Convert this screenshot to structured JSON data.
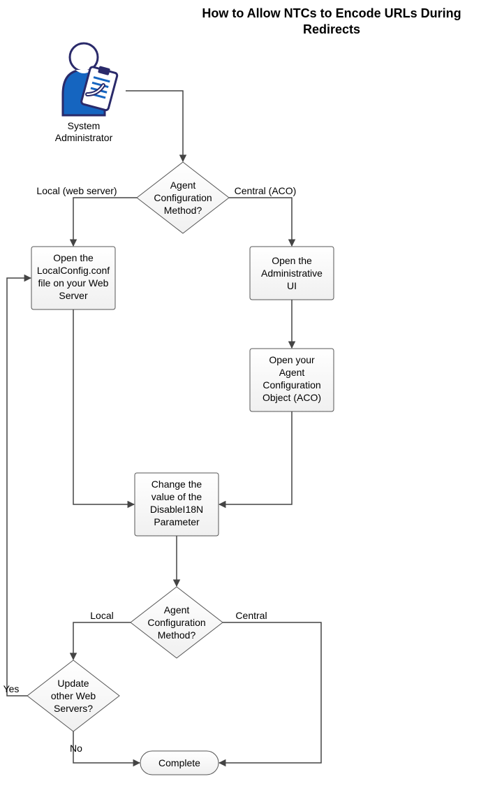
{
  "title": {
    "line1": "How to Allow NTCs to Encode URLs During",
    "line2": "Redirects"
  },
  "actor": {
    "label_line1": "System",
    "label_line2": "Administrator"
  },
  "decisions": {
    "d1": {
      "line1": "Agent",
      "line2": "Configuration",
      "line3": "Method?"
    },
    "d2": {
      "line1": "Agent",
      "line2": "Configuration",
      "line3": "Method?"
    },
    "d3": {
      "line1": "Update",
      "line2": "other Web",
      "line3": "Servers?"
    }
  },
  "boxes": {
    "local_open": {
      "line1": "Open the",
      "line2": "LocalConfig.conf",
      "line3": "file on your Web",
      "line4": "Server"
    },
    "admin_ui": {
      "line1": "Open the",
      "line2": "Administrative",
      "line3": "UI"
    },
    "open_aco": {
      "line1": "Open your",
      "line2": "Agent",
      "line3": "Configuration",
      "line4": "Object (ACO)"
    },
    "change_param": {
      "line1": "Change the",
      "line2": "value of the",
      "line3_bold": "DisableI18N",
      "line4": "Parameter"
    }
  },
  "edge_labels": {
    "d1_left": "Local (web server)",
    "d1_right": "Central (ACO)",
    "d2_left": "Local",
    "d2_right": "Central",
    "d3_yes": "Yes",
    "d3_no": "No"
  },
  "terminator": {
    "label": "Complete"
  },
  "chart_data": {
    "type": "flowchart",
    "title": "How to Allow NTCs to Encode URLs During Redirects",
    "actor": "System Administrator",
    "nodes": [
      {
        "id": "actor",
        "type": "actor",
        "label": "System Administrator"
      },
      {
        "id": "d1",
        "type": "decision",
        "label": "Agent Configuration Method?"
      },
      {
        "id": "n_local_open",
        "type": "process",
        "label": "Open the LocalConfig.conf file on your Web Server"
      },
      {
        "id": "n_admin_ui",
        "type": "process",
        "label": "Open the Administrative UI"
      },
      {
        "id": "n_open_aco",
        "type": "process",
        "label": "Open your Agent Configuration Object (ACO)"
      },
      {
        "id": "n_change_param",
        "type": "process",
        "label": "Change the value of the DisableI18N Parameter"
      },
      {
        "id": "d2",
        "type": "decision",
        "label": "Agent Configuration Method?"
      },
      {
        "id": "d3",
        "type": "decision",
        "label": "Update other Web Servers?"
      },
      {
        "id": "term",
        "type": "terminator",
        "label": "Complete"
      }
    ],
    "edges": [
      {
        "from": "actor",
        "to": "d1"
      },
      {
        "from": "d1",
        "to": "n_local_open",
        "label": "Local (web server)"
      },
      {
        "from": "d1",
        "to": "n_admin_ui",
        "label": "Central (ACO)"
      },
      {
        "from": "n_local_open",
        "to": "n_change_param"
      },
      {
        "from": "n_admin_ui",
        "to": "n_open_aco"
      },
      {
        "from": "n_open_aco",
        "to": "n_change_param"
      },
      {
        "from": "n_change_param",
        "to": "d2"
      },
      {
        "from": "d2",
        "to": "d3",
        "label": "Local"
      },
      {
        "from": "d2",
        "to": "term",
        "label": "Central"
      },
      {
        "from": "d3",
        "to": "n_local_open",
        "label": "Yes"
      },
      {
        "from": "d3",
        "to": "term",
        "label": "No"
      }
    ]
  }
}
